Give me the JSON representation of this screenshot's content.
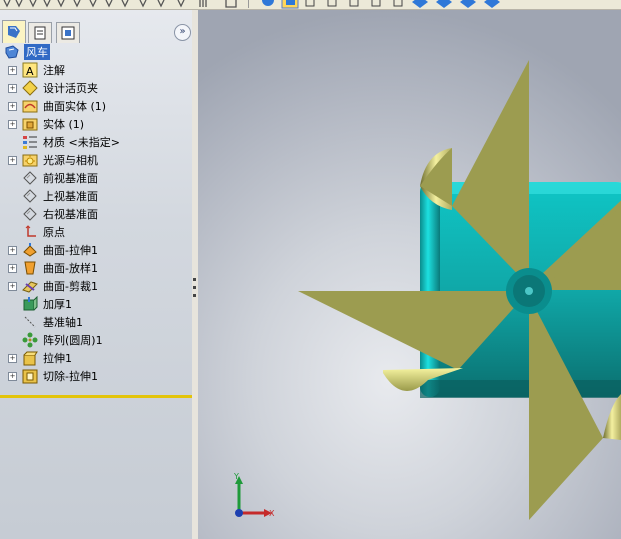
{
  "tabs": [
    {
      "icon": "feature-manager-icon",
      "active": true
    },
    {
      "icon": "property-manager-icon",
      "active": false
    },
    {
      "icon": "configuration-manager-icon",
      "active": false
    }
  ],
  "collapse_label": "»",
  "tree": {
    "root": {
      "label": "风车",
      "icon": "part-icon"
    },
    "items": [
      {
        "label": "注解",
        "icon": "annotations-icon",
        "expandable": true
      },
      {
        "label": "设计活页夹",
        "icon": "design-binder-icon",
        "expandable": true
      },
      {
        "label": "曲面实体 (1)",
        "icon": "surface-bodies-icon",
        "expandable": true
      },
      {
        "label": "实体 (1)",
        "icon": "solid-bodies-icon",
        "expandable": true
      },
      {
        "label": "材质 <未指定>",
        "icon": "material-icon",
        "expandable": false
      },
      {
        "label": "光源与相机",
        "icon": "lights-cameras-icon",
        "expandable": true
      },
      {
        "label": "前视基准面",
        "icon": "plane-icon",
        "expandable": false
      },
      {
        "label": "上视基准面",
        "icon": "plane-icon",
        "expandable": false
      },
      {
        "label": "右视基准面",
        "icon": "plane-icon",
        "expandable": false
      },
      {
        "label": "原点",
        "icon": "origin-icon",
        "expandable": false
      },
      {
        "label": "曲面-拉伸1",
        "icon": "surface-extrude-icon",
        "expandable": true
      },
      {
        "label": "曲面-放样1",
        "icon": "surface-loft-icon",
        "expandable": true
      },
      {
        "label": "曲面-剪裁1",
        "icon": "surface-trim-icon",
        "expandable": true
      },
      {
        "label": "加厚1",
        "icon": "thicken-icon",
        "expandable": false
      },
      {
        "label": "基准轴1",
        "icon": "axis-icon",
        "expandable": false
      },
      {
        "label": "阵列(圆周)1",
        "icon": "circular-pattern-icon",
        "expandable": false
      },
      {
        "label": "拉伸1",
        "icon": "extrude-icon",
        "expandable": true
      },
      {
        "label": "切除-拉伸1",
        "icon": "cut-extrude-icon",
        "expandable": true
      }
    ]
  },
  "triad": {
    "x_label": "X",
    "y_label": "Y"
  },
  "colors": {
    "blade": "#9c9c50",
    "hub": "#0ea5a5",
    "selection": "#316ac5",
    "rollback_bar": "#e3c40a"
  }
}
